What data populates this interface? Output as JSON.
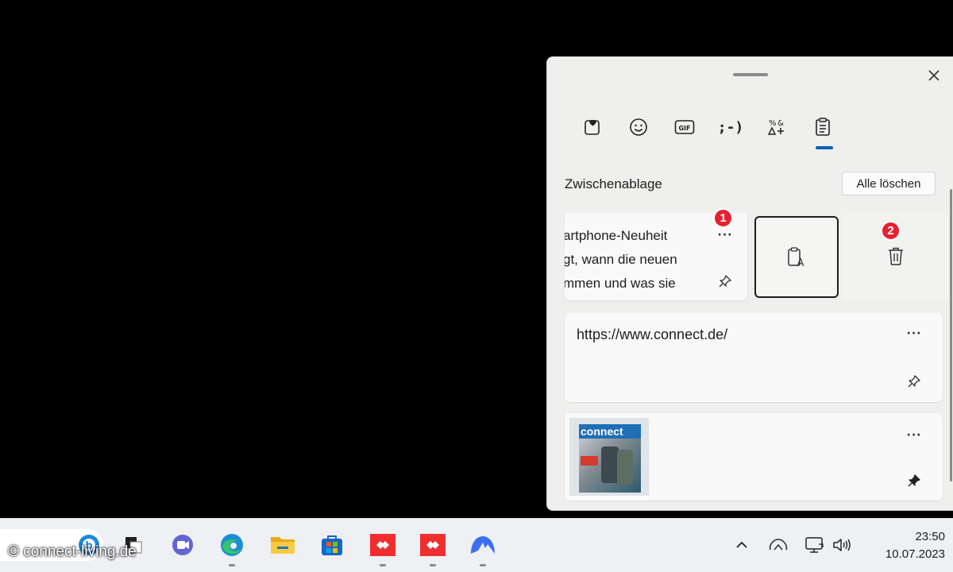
{
  "panel": {
    "tabs": [
      {
        "name": "favorites-icon"
      },
      {
        "name": "emoji-icon"
      },
      {
        "name": "gif-icon",
        "label": "GIF"
      },
      {
        "name": "kaomoji-icon",
        "label": ";-)"
      },
      {
        "name": "symbols-icon"
      },
      {
        "name": "clipboard-icon"
      }
    ],
    "active_tab": "clipboard",
    "section_title": "Zwischenablage",
    "clear_all_label": "Alle löschen",
    "items": [
      {
        "text": "artphone-Neuheit\ngt, wann die neuen\nmmen und was sie",
        "more": "···",
        "pinned": false
      },
      {
        "text": "https://www.connect.de/",
        "more": "···",
        "pinned": false
      },
      {
        "image_title": "connect",
        "more": "···",
        "pinned": true
      }
    ],
    "badges": [
      "1",
      "2"
    ],
    "accent_color": "#005fb8",
    "badge_color": "#e8202f"
  },
  "taskbar": {
    "apps": [
      "copilot-icon",
      "task-view-icon",
      "teams-icon",
      "edge-icon",
      "file-explorer-icon",
      "store-icon",
      "anydesk-icon",
      "anydesk-icon",
      "nordvpn-icon"
    ],
    "tray": [
      "chevron-up-icon",
      "onedrive-icon",
      "network-icon",
      "volume-icon"
    ],
    "time": "23:50",
    "date": "10.07.2023"
  },
  "watermark": "© connect-living.de"
}
